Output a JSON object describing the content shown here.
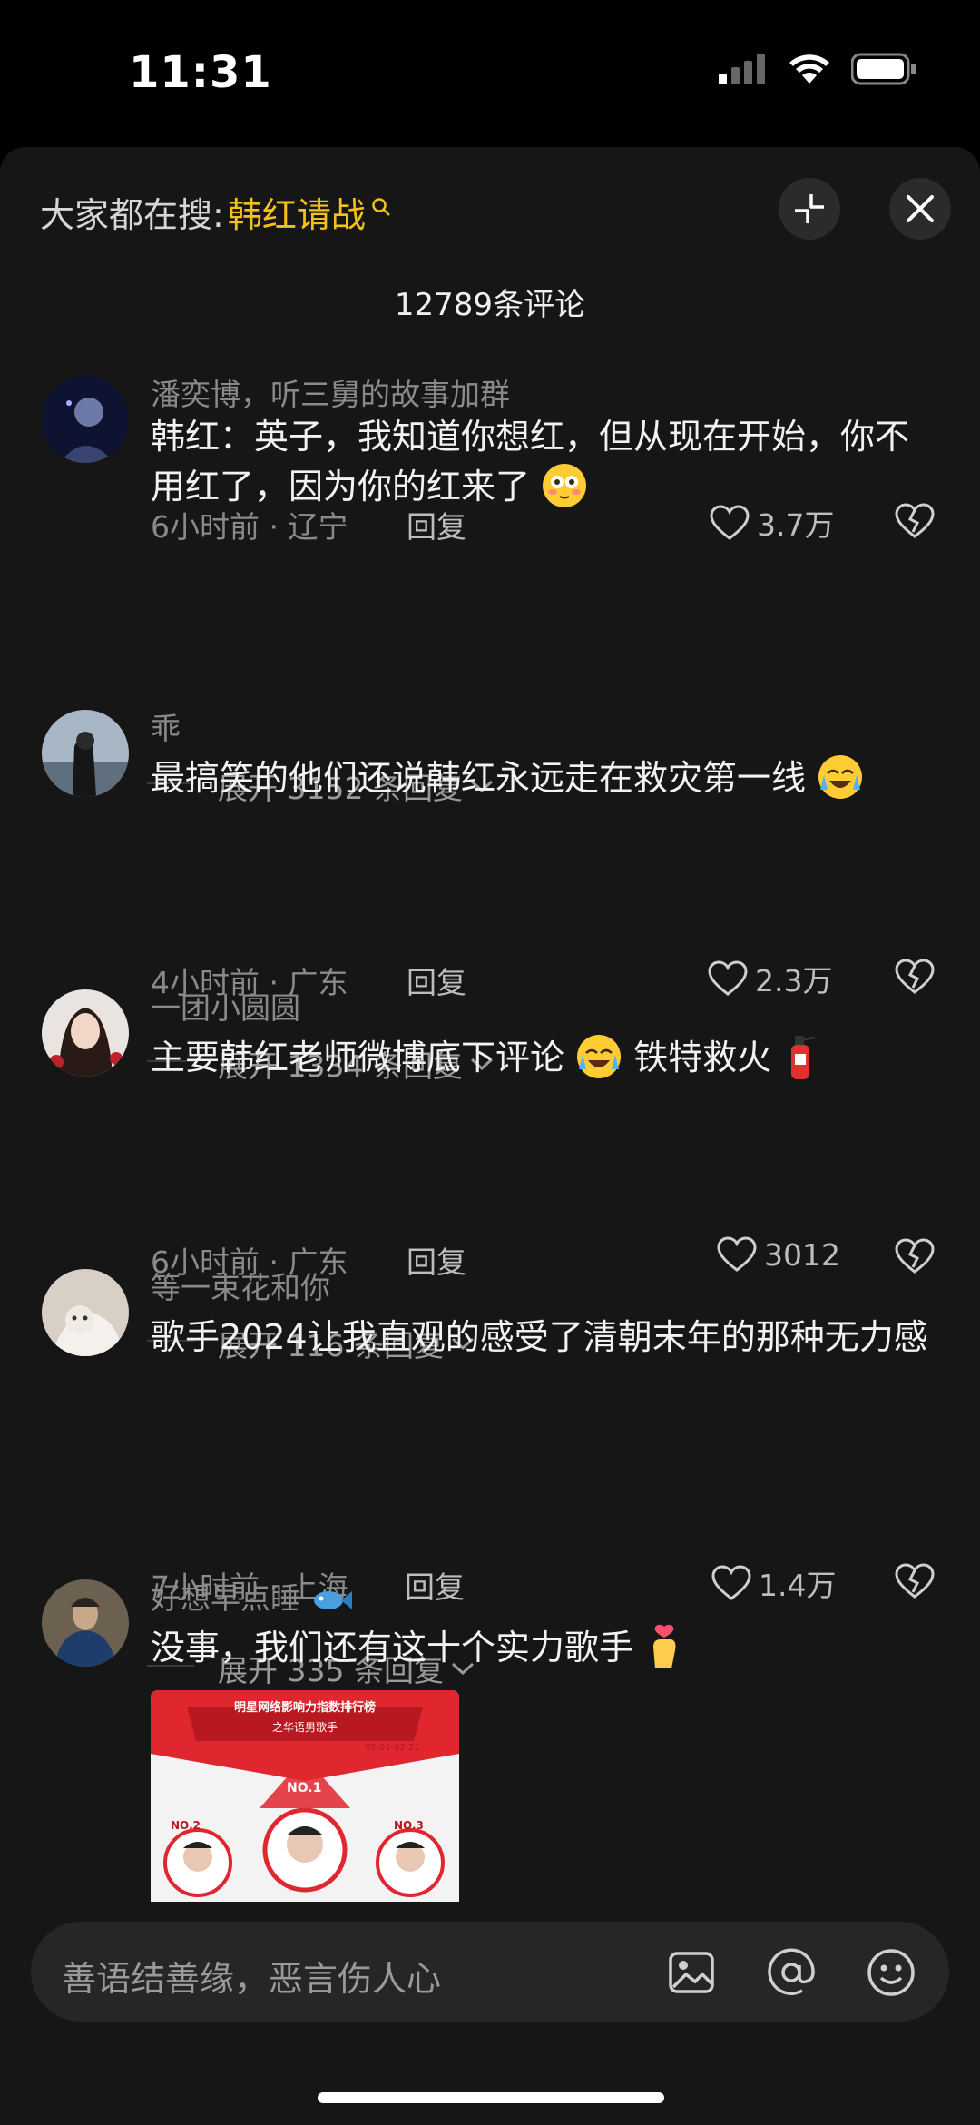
{
  "status_bar": {
    "time": "11:31"
  },
  "header": {
    "search_prefix": "大家都在搜:",
    "search_keyword": "韩红请战",
    "comment_count": "12789条评论"
  },
  "comments": [
    {
      "name": "潘奕博，听三舅的故事加群",
      "text": "韩红：英子，我知道你想红，但从现在开始，你不用红了，因为你的红来了",
      "emoji": "flushed-face",
      "time_location": "6小时前 · 辽宁",
      "reply": "回复",
      "likes": "3.7万",
      "expand": "展开 3152 条回复"
    },
    {
      "name": "乖",
      "text": "最搞笑的他们还说韩红永远走在救灾第一线",
      "emoji": "crying-face",
      "time_location": "4小时前 · 广东",
      "reply": "回复",
      "likes": "2.3万",
      "expand": "展开 1334 条回复"
    },
    {
      "name": "一团小圆圆",
      "text_before": "主要韩红老师微博底下评论",
      "text_after": "铁特救火",
      "time_location": "6小时前 · 广东",
      "reply": "回复",
      "likes": "3012",
      "expand": "展开 116 条回复"
    },
    {
      "name": "等一束花和你",
      "text": "歌手2024让我直观的感受了清朝末年的那种无力感",
      "time_location": "7小时前 · 上海",
      "reply": "回复",
      "likes": "1.4万",
      "expand": "展开 335 条回复"
    },
    {
      "name": "好想早点睡",
      "text": "没事，我们还有这十个实力歌手",
      "image": {
        "title": "明星网络影响力指数排行榜",
        "subtitle": "之华语男歌手",
        "date": "02.01-02.21",
        "rank1": "NO.1",
        "rank2": "NO.2",
        "rank3": "NO.3"
      }
    }
  ],
  "input": {
    "placeholder": "善语结善缘，恶言伤人心"
  },
  "colors": {
    "accent": "#f2c21b",
    "background": "#161616",
    "muted": "#8a8a8a"
  }
}
